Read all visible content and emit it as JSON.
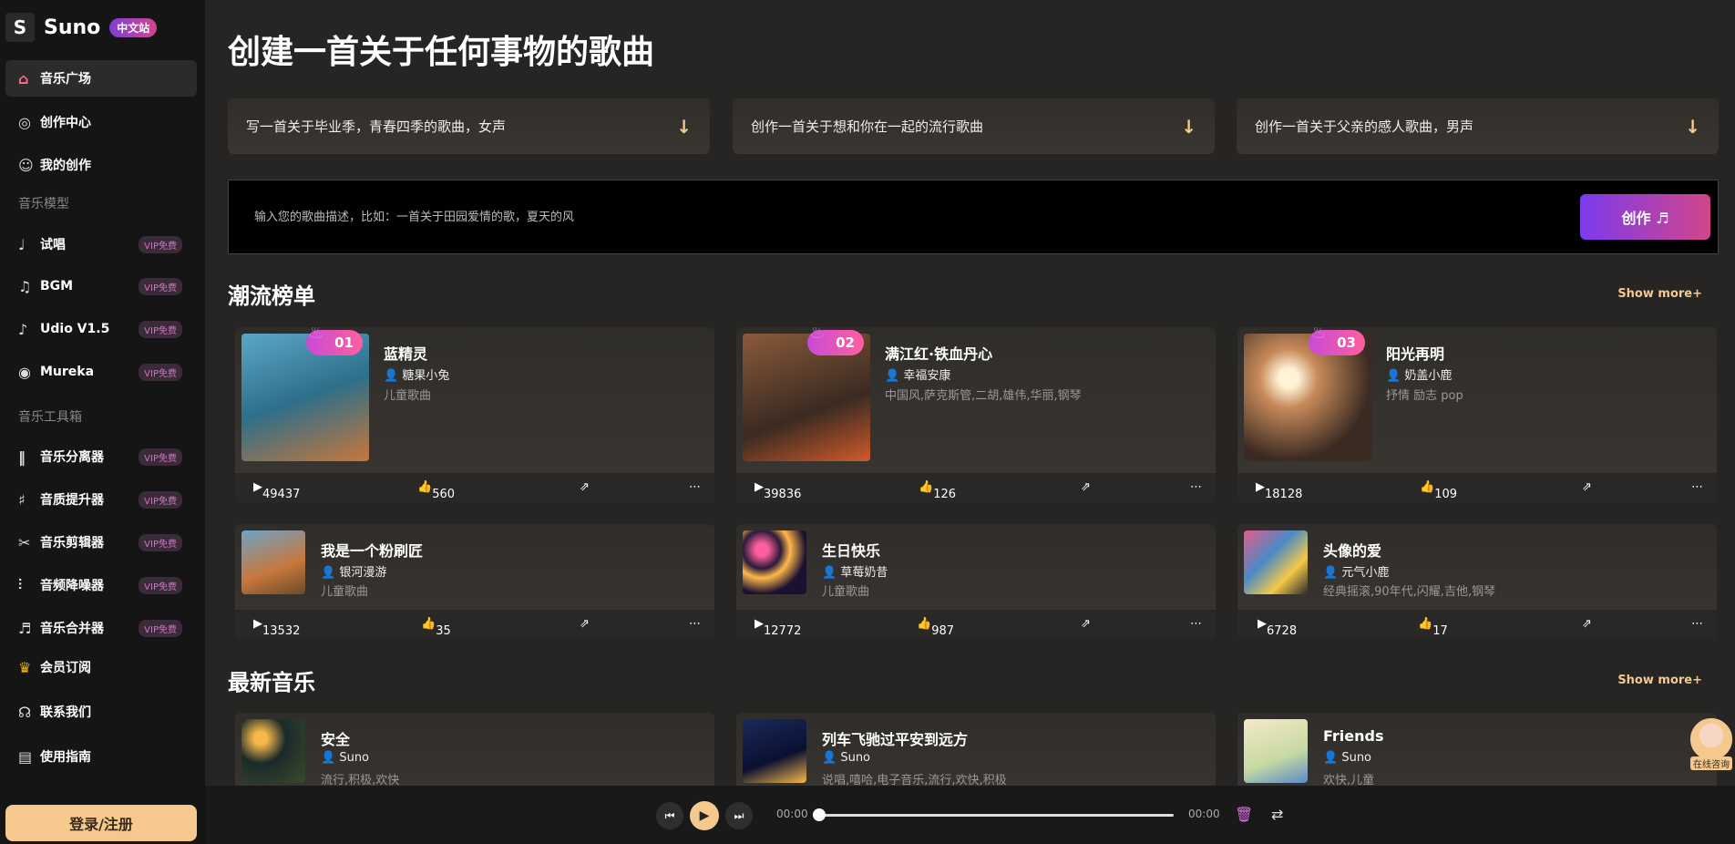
{
  "brand": {
    "name": "Suno",
    "badge": "中文站"
  },
  "nav": {
    "items": [
      {
        "label": "音乐广场",
        "icon": "home-icon"
      },
      {
        "label": "创作中心",
        "icon": "compass-icon"
      },
      {
        "label": "我的创作",
        "icon": "user-music-icon"
      },
      {
        "label": "试唱",
        "icon": "mic-icon",
        "vip": "VIP免费"
      },
      {
        "label": "BGM",
        "icon": "music-note-icon",
        "vip": "VIP免费"
      },
      {
        "label": "Udio V1.5",
        "icon": "music-note-icon",
        "vip": "VIP免费"
      },
      {
        "label": "Mureka",
        "icon": "disc-icon",
        "vip": "VIP免费"
      },
      {
        "label": "音乐分离器",
        "icon": "waveform-icon",
        "vip": "VIP免费"
      },
      {
        "label": "音质提升器",
        "icon": "tuning-icon",
        "vip": "VIP免费"
      },
      {
        "label": "音乐剪辑器",
        "icon": "scissors-icon",
        "vip": "VIP免费"
      },
      {
        "label": "音频降噪器",
        "icon": "sliders-icon",
        "vip": "VIP免费"
      },
      {
        "label": "音乐合并器",
        "icon": "merge-icon",
        "vip": "VIP免费"
      },
      {
        "label": "会员订阅",
        "icon": "crown-icon"
      },
      {
        "label": "联系我们",
        "icon": "headset-icon"
      },
      {
        "label": "使用指南",
        "icon": "book-icon"
      }
    ],
    "section_models": "音乐模型",
    "section_tools": "音乐工具箱",
    "login": "登录/注册"
  },
  "hero": {
    "title": "创建一首关于任何事物的歌曲",
    "prompts": [
      "写一首关于毕业季，青春四季的歌曲，女声",
      "创作一首关于想和你在一起的流行歌曲",
      "创作一首关于父亲的感人歌曲，男声"
    ],
    "input_placeholder": "输入您的歌曲描述，比如：一首关于田园爱情的歌，夏天的风",
    "create_label": "创作 ♬"
  },
  "trending": {
    "title": "潮流榜单",
    "show_more": "Show more+",
    "cards": [
      {
        "rank": "01",
        "title": "蓝精灵",
        "author": "糖果小兔",
        "tags": "儿童歌曲",
        "plays": "49437",
        "likes": "560"
      },
      {
        "rank": "02",
        "title": "满江红·铁血丹心",
        "author": "幸福安康",
        "tags": "中国风,萨克斯管,二胡,雄伟,华丽,钢琴",
        "plays": "39836",
        "likes": "126"
      },
      {
        "rank": "03",
        "title": "阳光再明",
        "author": "奶盖小鹿",
        "tags": "抒情 励志 pop",
        "plays": "18128",
        "likes": "109"
      },
      {
        "title": "我是一个粉刷匠",
        "author": "银河漫游",
        "tags": "儿童歌曲",
        "plays": "13532",
        "likes": "35"
      },
      {
        "title": "生日快乐",
        "author": "草莓奶昔",
        "tags": "儿童歌曲",
        "plays": "12772",
        "likes": "987"
      },
      {
        "title": "头像的爱",
        "author": "元气小鹿",
        "tags": "经典摇滚,90年代,闪耀,吉他,钢琴",
        "plays": "6728",
        "likes": "17"
      }
    ]
  },
  "latest": {
    "title": "最新音乐",
    "show_more": "Show more+",
    "cards": [
      {
        "title": "安全",
        "author": "Suno",
        "tags": "流行,积极,欢快"
      },
      {
        "title": "列车飞驰过平安到远方",
        "author": "Suno",
        "tags": "说唱,嘻哈,电子音乐,流行,欢快,积极"
      },
      {
        "title": "Friends",
        "author": "Suno",
        "tags": "欢快,儿童"
      }
    ]
  },
  "player": {
    "current": "00:00",
    "total": "00:00"
  },
  "helper": {
    "label": "在线咨询"
  }
}
